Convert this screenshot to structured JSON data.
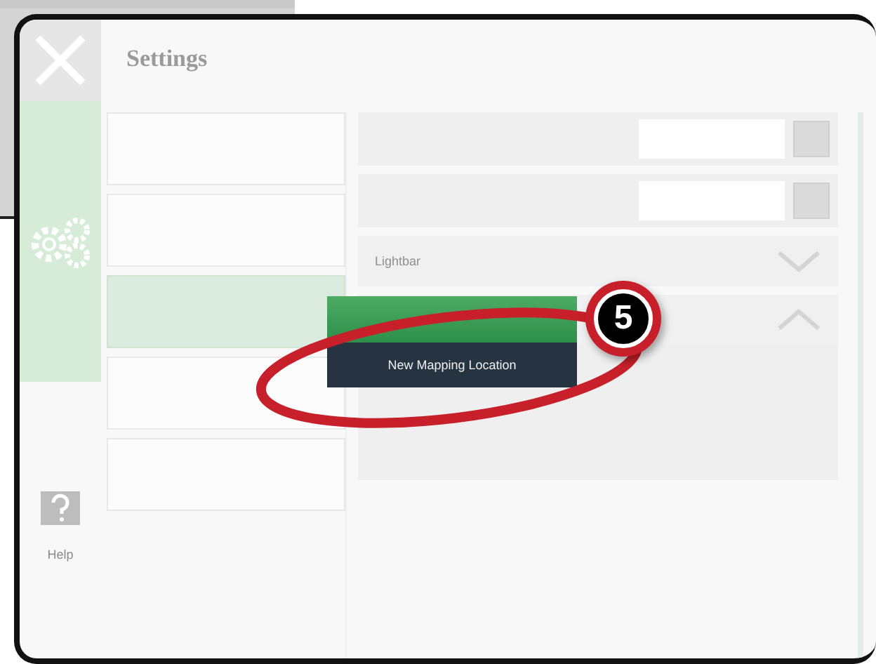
{
  "window": {
    "title": "Settings"
  },
  "rail": [
    {
      "kind": "close"
    },
    {
      "kind": "settings",
      "selected": true
    },
    {
      "kind": "help",
      "label": "Help",
      "selected": false
    }
  ],
  "menu": [
    {
      "selected": false
    },
    {
      "selected": false
    },
    {
      "selected": true
    },
    {
      "selected": false
    },
    {
      "selected": false
    }
  ],
  "panel_rows": [
    {
      "kind": "field"
    },
    {
      "kind": "field"
    },
    {
      "kind": "section",
      "label": "Lightbar",
      "expanded": false
    },
    {
      "kind": "section",
      "expanded": true
    }
  ],
  "popup": {
    "buttons": [
      {
        "kind": "primary"
      },
      {
        "kind": "secondary",
        "label": "New Mapping Location"
      }
    ]
  },
  "callout": {
    "number": "5"
  }
}
